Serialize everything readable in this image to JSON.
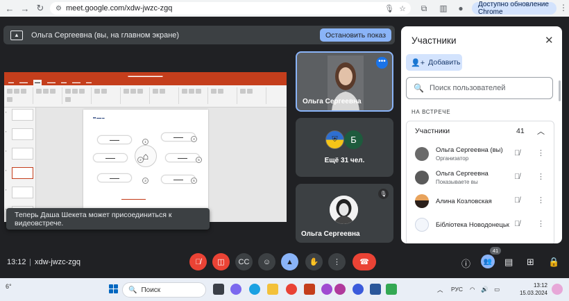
{
  "browser": {
    "url": "meet.google.com/xdw-jwzc-zgq",
    "update_label": "Доступно обновление Chrome"
  },
  "presenting": {
    "message": "Ольга Сергеевна (вы, на главном экране)",
    "stop_label": "Остановить показ"
  },
  "toast": {
    "message": "Теперь Даша Шекета может присоединиться к видеовстрече."
  },
  "tiles": {
    "self_name": "Ольга Сергеевна",
    "more_count": "Ещё 31 чел.",
    "avatar_letter": "Б",
    "bottom_name": "Ольга Сергеевна"
  },
  "panel": {
    "title": "Участники",
    "add_label": "Добавить",
    "search_placeholder": "Поиск пользователей",
    "section_label": "НА ВСТРЕЧЕ",
    "group_label": "Участники",
    "group_count": "41",
    "participants": [
      {
        "name": "Ольга Сергеевна (вы)",
        "role": "Организатор"
      },
      {
        "name": "Ольга Сергеевна",
        "role": "Показываете вы"
      },
      {
        "name": "Алина Козловская",
        "role": ""
      },
      {
        "name": "Бібліотека Новодонецьк",
        "role": ""
      }
    ]
  },
  "meeting": {
    "time": "13:12",
    "code": "xdw-jwzc-zgq",
    "people_badge": "41"
  },
  "taskbar": {
    "temperature": "6°",
    "search_label": "Поиск",
    "language": "РУС",
    "time": "13:12",
    "date": "15.03.2024"
  },
  "colors": {
    "accent_blue": "#8ab4f8",
    "end_call_red": "#ea4335",
    "meet_background": "#202124",
    "tile_background": "#3c4043"
  }
}
